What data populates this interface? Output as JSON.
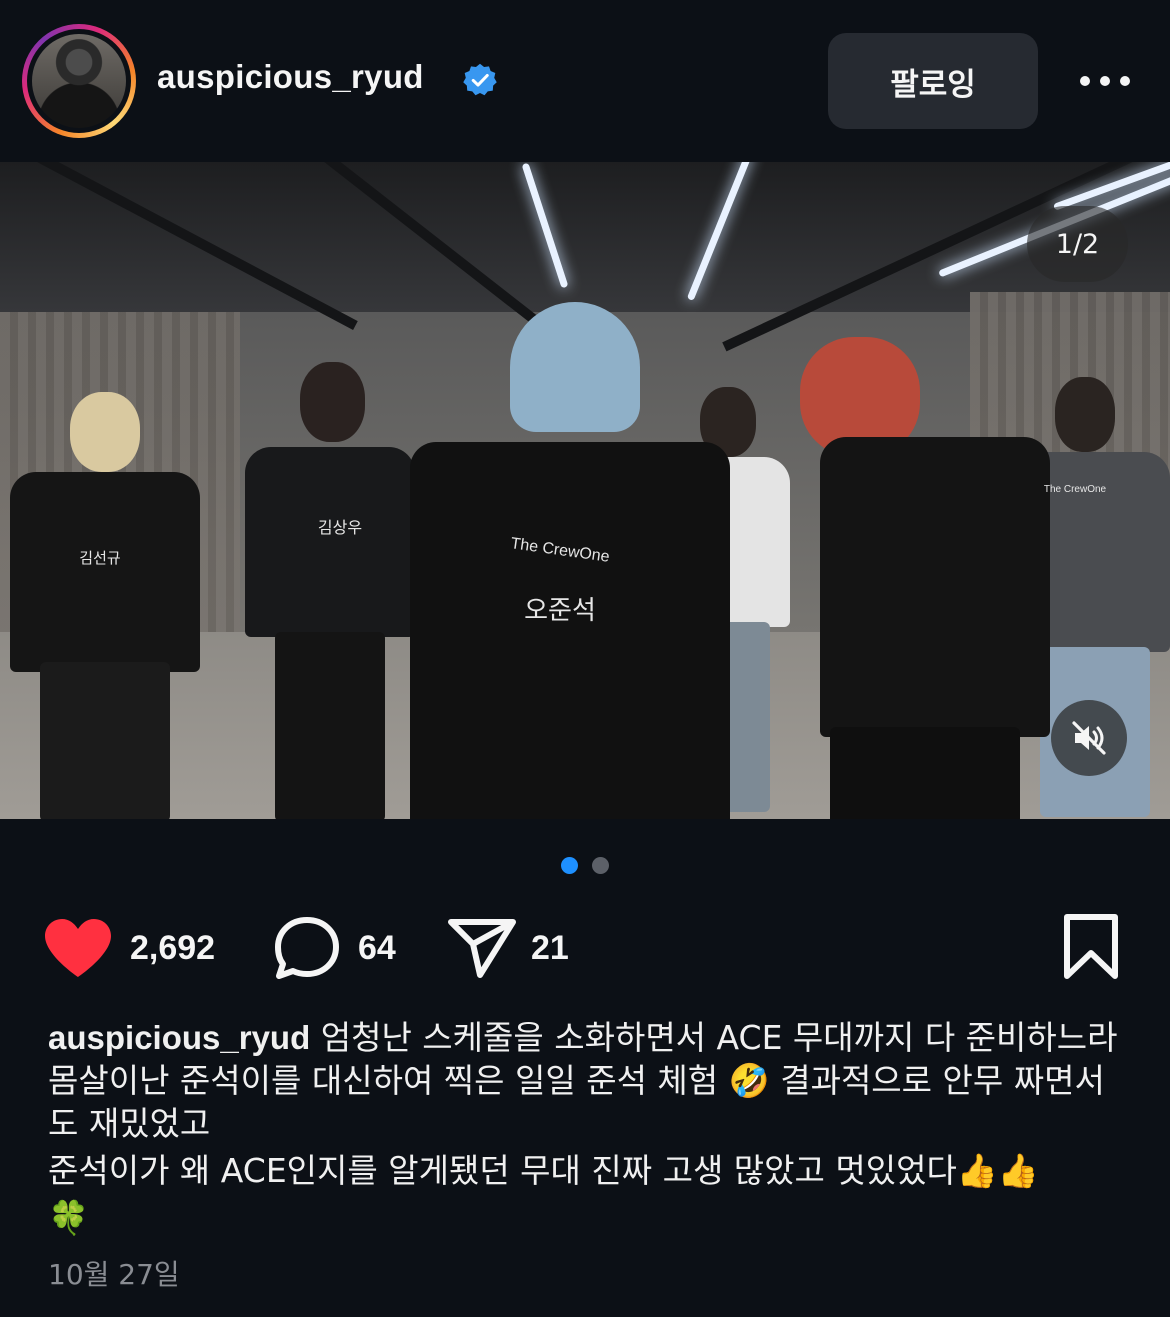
{
  "header": {
    "username": "auspicious_ryud",
    "verified": true,
    "follow_label": "팔로잉",
    "more_icon": "more-horizontal-icon"
  },
  "media": {
    "counter": "1/2",
    "mute_icon": "speaker-muted-icon",
    "page_count": 2,
    "current_page": 1,
    "vest_labels": [
      "The CrewOne",
      "오준석",
      "김상우",
      "김선규",
      "The CrewOne"
    ]
  },
  "actions": {
    "like_count": "2,692",
    "comment_count": "64",
    "share_count": "21",
    "liked": true
  },
  "caption": {
    "username": "auspicious_ryud",
    "paragraph1": " 엄청난 스케줄을 소화하면서 ACE 무대까지 다 준비하느라 몸살이난 준석이를 대신하여 찍은 일일 준석 체험",
    "emoji1": "🤣",
    "paragraph1_tail": " 결과적으로 안무 짜면서도 재밌었고",
    "paragraph2": "준석이가 왜 ACE인지를 알게됐던 무대 진짜 고생 많았고 멋있었다",
    "emoji2": "👍👍",
    "emoji3": "🍀"
  },
  "date": "10월 27일",
  "colors": {
    "background": "#0c1016",
    "like_red": "#ff3040",
    "verified_blue": "#3897f0",
    "dot_active": "#1e90ff"
  }
}
